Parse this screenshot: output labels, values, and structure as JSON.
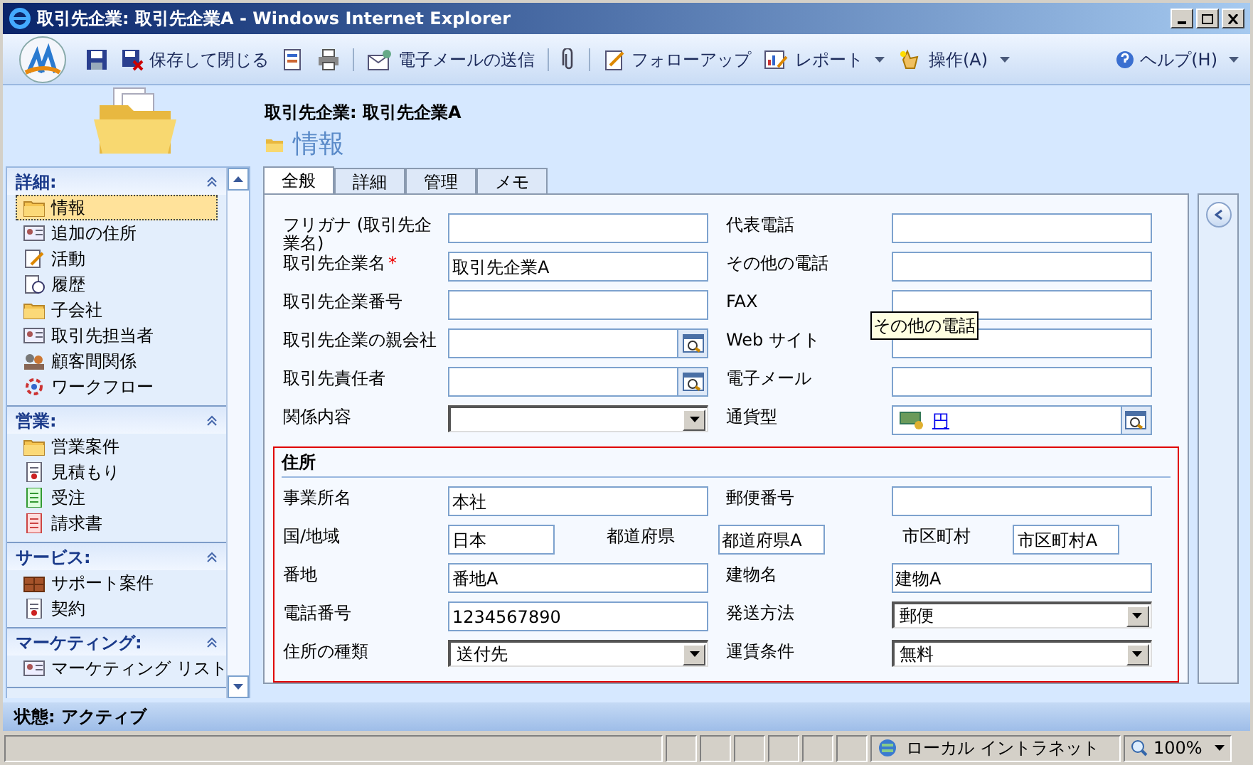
{
  "window": {
    "title": "取引先企業: 取引先企業A - Windows Internet Explorer"
  },
  "toolbar": {
    "items": [
      {
        "kind": "icon"
      },
      {
        "kind": "labeled",
        "label": "保存して閉じる",
        "dropdown": false
      },
      {
        "kind": "icon"
      },
      {
        "kind": "icon"
      },
      {
        "kind": "separator"
      },
      {
        "kind": "labeled",
        "label": "電子メールの送信",
        "dropdown": false
      },
      {
        "kind": "separator"
      },
      {
        "kind": "icon"
      },
      {
        "kind": "separator"
      },
      {
        "kind": "labeled",
        "label": "フォローアップ",
        "dropdown": false
      },
      {
        "kind": "labeled",
        "label": "レポート",
        "dropdown": true
      },
      {
        "kind": "labeled",
        "label": "操作(A)",
        "dropdown": true
      }
    ],
    "help": {
      "label": "ヘルプ(H)",
      "dropdown": true
    }
  },
  "header": {
    "record": "取引先企業: 取引先企業A",
    "section": "情報"
  },
  "sidebar": {
    "groups": [
      {
        "title": "詳細:",
        "expanded": true,
        "items": [
          {
            "label": "情報",
            "selected": true
          },
          {
            "label": "追加の住所",
            "selected": false
          },
          {
            "label": "活動",
            "selected": false
          },
          {
            "label": "履歴",
            "selected": false
          },
          {
            "label": "子会社",
            "selected": false
          },
          {
            "label": "取引先担当者",
            "selected": false
          },
          {
            "label": "顧客間関係",
            "selected": false
          },
          {
            "label": "ワークフロー",
            "selected": false
          }
        ]
      },
      {
        "title": "営業:",
        "expanded": true,
        "items": [
          {
            "label": "営業案件",
            "selected": false
          },
          {
            "label": "見積もり",
            "selected": false
          },
          {
            "label": "受注",
            "selected": false
          },
          {
            "label": "請求書",
            "selected": false
          }
        ]
      },
      {
        "title": "サービス:",
        "expanded": true,
        "items": [
          {
            "label": "サポート案件",
            "selected": false
          },
          {
            "label": "契約",
            "selected": false
          }
        ]
      },
      {
        "title": "マーケティング:",
        "expanded": true,
        "items": [
          {
            "label": "マーケティング リスト",
            "selected": false
          }
        ]
      }
    ]
  },
  "tabs": [
    {
      "label": "全般",
      "selected": true
    },
    {
      "label": "詳細",
      "selected": false
    },
    {
      "label": "管理",
      "selected": false
    },
    {
      "label": "メモ",
      "selected": false
    }
  ],
  "general": {
    "rows": [
      [
        {
          "label": "フリガナ (取引先企業名)",
          "kind": "text"
        },
        {
          "label": "代表電話",
          "kind": "text"
        }
      ],
      [
        {
          "label": "取引先企業名",
          "kind": "text",
          "value": "取引先企業A",
          "required_mark": "*"
        },
        {
          "label": "その他の電話",
          "kind": "text"
        }
      ],
      [
        {
          "label": "取引先企業番号",
          "kind": "text"
        },
        {
          "label": "FAX",
          "kind": "text"
        }
      ],
      [
        {
          "label": "取引先企業の親会社",
          "kind": "lookup"
        },
        {
          "label": "Web サイト",
          "kind": "text"
        }
      ],
      [
        {
          "label": "取引先責任者",
          "kind": "lookup"
        },
        {
          "label": "電子メール",
          "kind": "text"
        }
      ],
      [
        {
          "label": "関係内容",
          "kind": "select"
        },
        {
          "label": "通貨型",
          "kind": "currency",
          "value": "円"
        }
      ]
    ]
  },
  "address": {
    "title": "住所",
    "rows": [
      [
        {
          "label": "事業所名",
          "kind": "text",
          "value": "本社"
        },
        {
          "label": "郵便番号",
          "kind": "text"
        }
      ],
      [
        {
          "label": "国/地域",
          "kind": "text",
          "value": "日本"
        },
        {
          "label": "都道府県",
          "kind": "text",
          "value": "都道府県A"
        },
        {
          "label": "市区町村",
          "kind": "text",
          "value": "市区町村A"
        }
      ],
      [
        {
          "label": "番地",
          "kind": "text",
          "value": "番地A"
        },
        {
          "label": "建物名",
          "kind": "text",
          "value": "建物A"
        }
      ],
      [
        {
          "label": "電話番号",
          "kind": "text",
          "value": "1234567890"
        },
        {
          "label": "発送方法",
          "kind": "select",
          "value": "郵便"
        }
      ],
      [
        {
          "label": "住所の種類",
          "kind": "select",
          "value": "送付先"
        },
        {
          "label": "運賃条件",
          "kind": "select",
          "value": "無料"
        }
      ]
    ]
  },
  "tooltip": {
    "text": "その他の電話"
  },
  "record_status": "状態: アクティブ",
  "ie_status": {
    "zone": "ローカル イントラネット",
    "zoom": "100%"
  }
}
